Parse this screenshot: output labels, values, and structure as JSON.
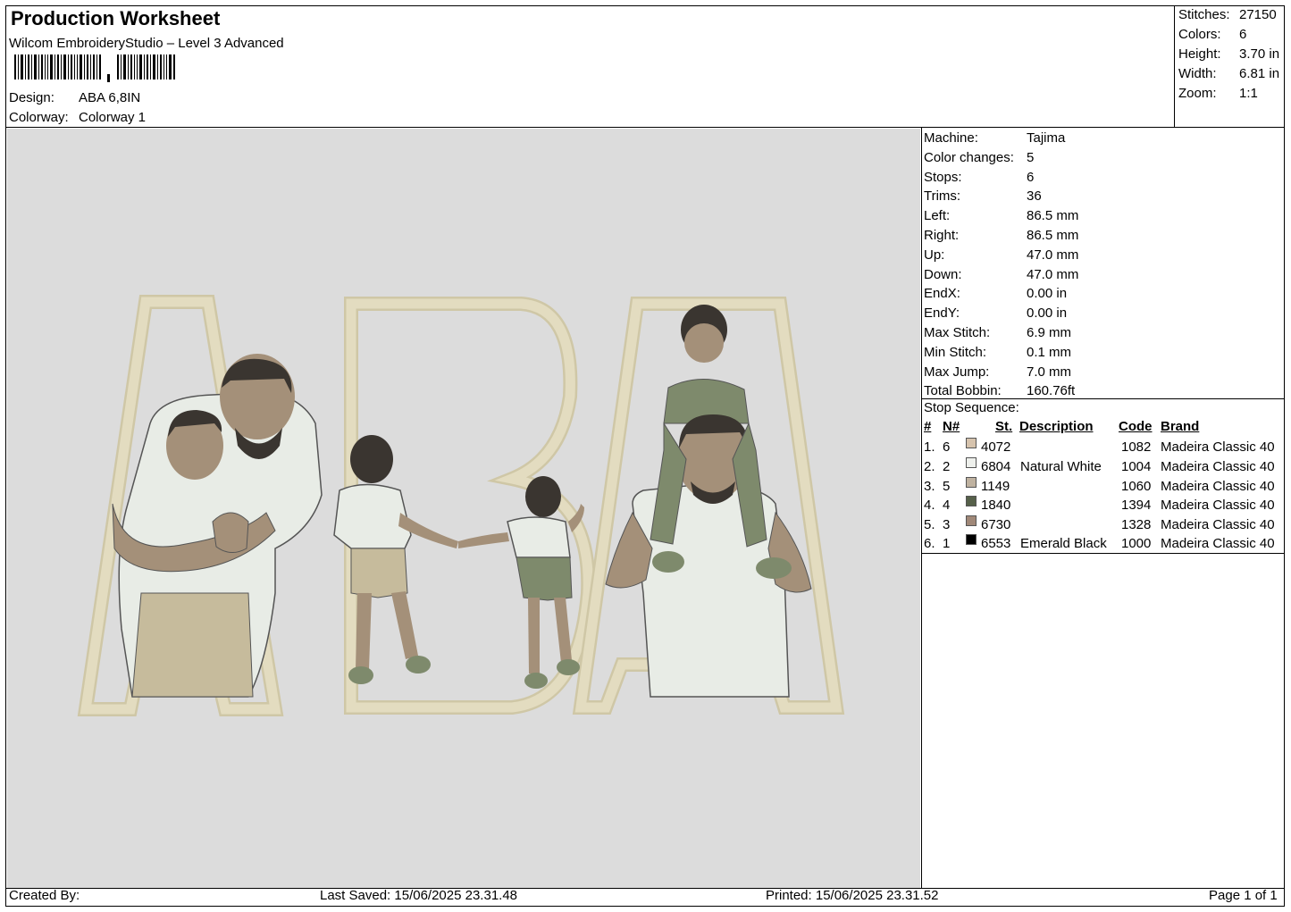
{
  "header": {
    "title": "Production Worksheet",
    "software": "Wilcom EmbroideryStudio – Level 3 Advanced",
    "design_label": "Design:",
    "design_value": "ABA 6,8IN",
    "colorway_label": "Colorway:",
    "colorway_value": "Colorway 1"
  },
  "summary": [
    {
      "label": "Stitches:",
      "value": "27150"
    },
    {
      "label": "Colors:",
      "value": "6"
    },
    {
      "label": "Height:",
      "value": "3.70 in"
    },
    {
      "label": "Width:",
      "value": "6.81 in"
    },
    {
      "label": "Zoom:",
      "value": "1:1"
    }
  ],
  "machine_info": [
    {
      "label": "Machine:",
      "value": "Tajima"
    },
    {
      "label": "Color changes:",
      "value": "5"
    },
    {
      "label": "Stops:",
      "value": "6"
    },
    {
      "label": "Trims:",
      "value": "36"
    },
    {
      "label": "Left:",
      "value": "86.5 mm"
    },
    {
      "label": "Right:",
      "value": "86.5 mm"
    },
    {
      "label": "Up:",
      "value": "47.0 mm"
    },
    {
      "label": "Down:",
      "value": "47.0 mm"
    },
    {
      "label": "EndX:",
      "value": "0.00 in"
    },
    {
      "label": "EndY:",
      "value": "0.00 in"
    },
    {
      "label": "Max Stitch:",
      "value": "6.9 mm"
    },
    {
      "label": "Min Stitch:",
      "value": "0.1 mm"
    },
    {
      "label": "Max Jump:",
      "value": "7.0 mm"
    },
    {
      "label": "Total Bobbin:",
      "value": "160.76ft"
    }
  ],
  "stop_sequence": {
    "title": "Stop Sequence:",
    "columns": {
      "num": "#",
      "n": "N#",
      "st": "St.",
      "description": "Description",
      "code": "Code",
      "brand": "Brand"
    },
    "rows": [
      {
        "num": "1.",
        "n": "6",
        "st": "4072",
        "description": "",
        "code": "1082",
        "brand": "Madeira Classic 40",
        "color": "#d6c3ad"
      },
      {
        "num": "2.",
        "n": "2",
        "st": "6804",
        "description": "Natural White",
        "code": "1004",
        "brand": "Madeira Classic 40",
        "color": "#eef0ec"
      },
      {
        "num": "3.",
        "n": "5",
        "st": "1149",
        "description": "",
        "code": "1060",
        "brand": "Madeira Classic 40",
        "color": "#bfb2a0"
      },
      {
        "num": "4.",
        "n": "4",
        "st": "1840",
        "description": "",
        "code": "1394",
        "brand": "Madeira Classic 40",
        "color": "#56604a"
      },
      {
        "num": "5.",
        "n": "3",
        "st": "6730",
        "description": "",
        "code": "1328",
        "brand": "Madeira Classic 40",
        "color": "#a08878"
      },
      {
        "num": "6.",
        "n": "1",
        "st": "6553",
        "description": "Emerald Black",
        "code": "1000",
        "brand": "Madeira Classic 40",
        "color": "#000000"
      }
    ]
  },
  "design_preview": {
    "letters": [
      "A",
      "B",
      "A"
    ],
    "colors": {
      "background": "#dcdcdc",
      "outline": "#e3dcc0",
      "outline_edge": "#cfc7a6",
      "skin": "#a49079",
      "shirt": "#e8ece6",
      "pants": "#c6bb9c",
      "green": "#7e8a6c",
      "hair": "#3a3530"
    }
  },
  "footer": {
    "created_by": "Created By:",
    "last_saved": "Last Saved: 15/06/2025 23.31.48",
    "printed": "Printed: 15/06/2025 23.31.52",
    "page": "Page 1 of 1"
  }
}
